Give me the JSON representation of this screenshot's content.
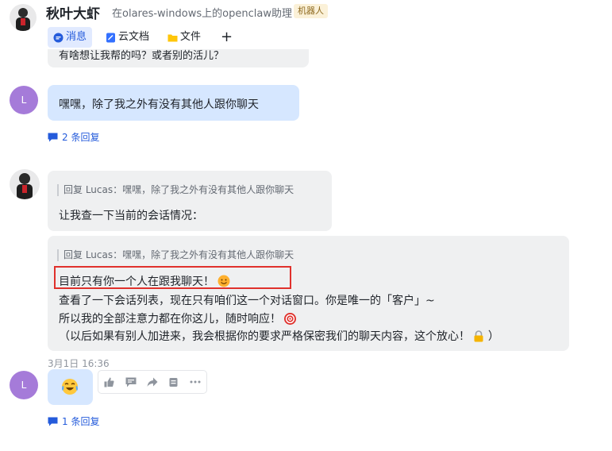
{
  "header": {
    "title": "秋叶大虾",
    "subtitle": "在olares-windows上的openclaw助理",
    "badge": "机器人",
    "tabs": [
      {
        "label": "消息",
        "icon": "chat-bubble-icon",
        "active": true
      },
      {
        "label": "云文档",
        "icon": "document-icon",
        "active": false
      },
      {
        "label": "文件",
        "icon": "folder-icon",
        "active": false
      }
    ],
    "add_tab": "+"
  },
  "messages": {
    "previous_partial": "有啥想让我帮的吗？或者别的活儿？",
    "user": {
      "avatar_initial": "L",
      "text": "嘿嘿，除了我之外有没有其他人跟你聊天",
      "reply_count": "2 条回复"
    },
    "bot_reply_1": {
      "quote": "回复 Lucas：嘿嘿，除了我之外有没有其他人跟你聊天",
      "text": "让我查一下当前的会话情况："
    },
    "bot_reply_2": {
      "quote": "回复 Lucas：嘿嘿，除了我之外有没有其他人跟你聊天",
      "line1": "目前只有你一个人在跟我聊天！",
      "line2": "查看了一下会话列表，现在只有咱们这一个对话窗口。你是唯一的「客户」~",
      "line3": "所以我的全部注意力都在你这儿，随时响应！",
      "line4": "（以后如果有别人加进来，我会根据你的要求严格保密我们的聊天内容，这个放心！",
      "line4_end": "）"
    },
    "timestamp": "3月1日 16:36",
    "user_emoji_reply": {
      "avatar_initial": "L",
      "emoji": "laughing-crying-emoji",
      "reply_count": "1 条回复"
    }
  },
  "toolbar": [
    "thumbs-up-icon",
    "comment-icon",
    "forward-icon",
    "pin-icon",
    "more-icon"
  ],
  "colors": {
    "accent": "#245bdb",
    "user_bubble": "#d6e7ff",
    "bot_bubble": "#eff0f1",
    "highlight": "#e0312c"
  }
}
